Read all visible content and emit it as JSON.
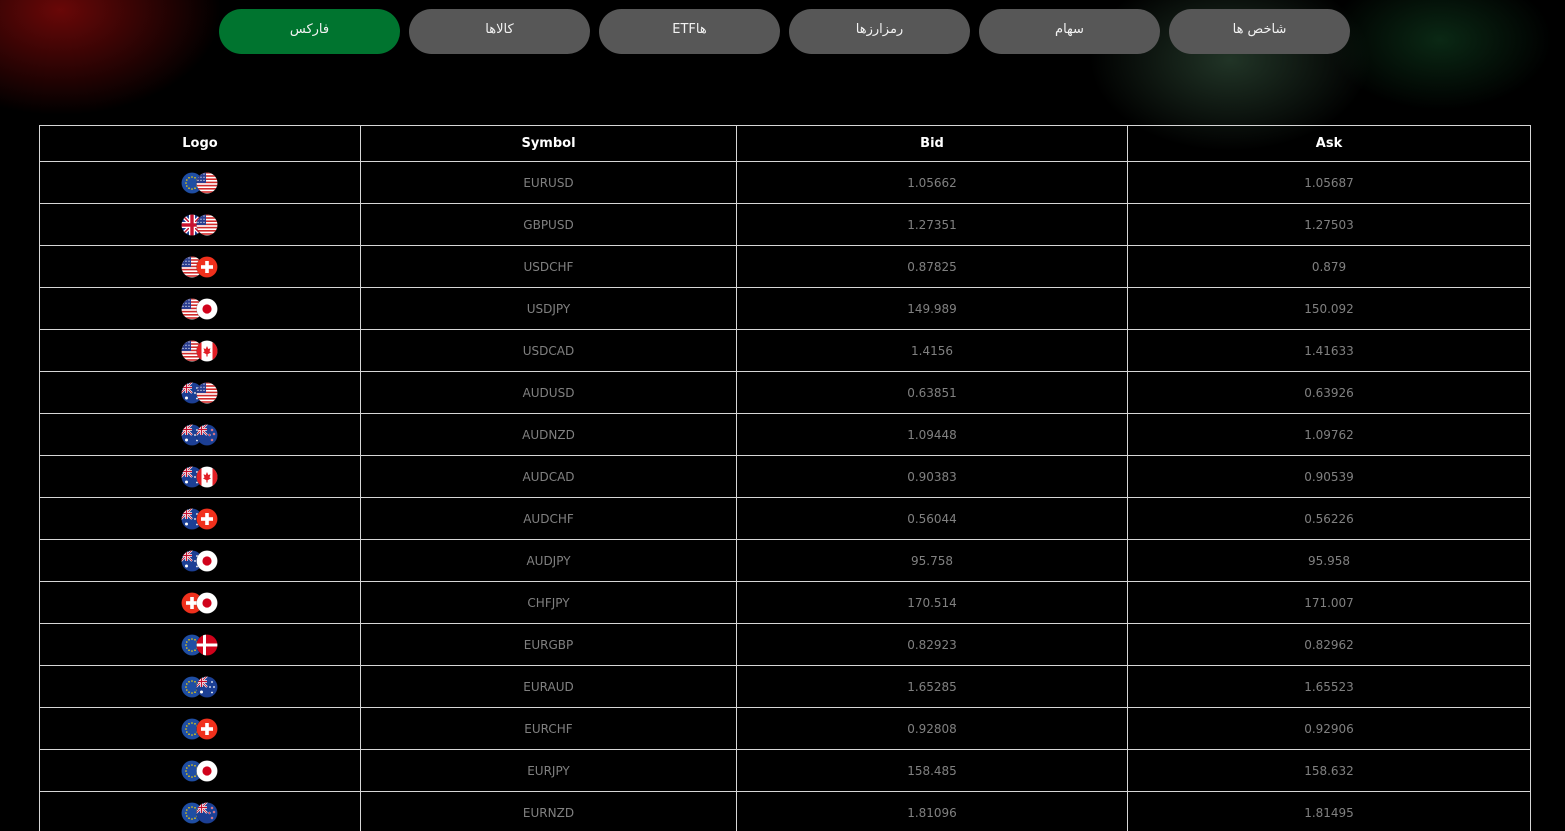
{
  "tabs": [
    {
      "label": "فارکس",
      "active": true
    },
    {
      "label": "کالاها",
      "active": false
    },
    {
      "label": "ETFها",
      "active": false
    },
    {
      "label": "رمزارزها",
      "active": false
    },
    {
      "label": "سهام",
      "active": false
    },
    {
      "label": "شاخص ها",
      "active": false
    }
  ],
  "table": {
    "headers": {
      "logo": "Logo",
      "symbol": "Symbol",
      "bid": "Bid",
      "ask": "Ask"
    },
    "rows": [
      {
        "symbol": "EURUSD",
        "bid": "1.05662",
        "ask": "1.05687",
        "flags": [
          "eu",
          "us"
        ]
      },
      {
        "symbol": "GBPUSD",
        "bid": "1.27351",
        "ask": "1.27503",
        "flags": [
          "gb",
          "us"
        ]
      },
      {
        "symbol": "USDCHF",
        "bid": "0.87825",
        "ask": "0.879",
        "flags": [
          "us",
          "ch"
        ]
      },
      {
        "symbol": "USDJPY",
        "bid": "149.989",
        "ask": "150.092",
        "flags": [
          "us",
          "jp"
        ]
      },
      {
        "symbol": "USDCAD",
        "bid": "1.4156",
        "ask": "1.41633",
        "flags": [
          "us",
          "ca"
        ]
      },
      {
        "symbol": "AUDUSD",
        "bid": "0.63851",
        "ask": "0.63926",
        "flags": [
          "au",
          "us"
        ]
      },
      {
        "symbol": "AUDNZD",
        "bid": "1.09448",
        "ask": "1.09762",
        "flags": [
          "au",
          "nz"
        ]
      },
      {
        "symbol": "AUDCAD",
        "bid": "0.90383",
        "ask": "0.90539",
        "flags": [
          "au",
          "ca"
        ]
      },
      {
        "symbol": "AUDCHF",
        "bid": "0.56044",
        "ask": "0.56226",
        "flags": [
          "au",
          "ch"
        ]
      },
      {
        "symbol": "AUDJPY",
        "bid": "95.758",
        "ask": "95.958",
        "flags": [
          "au",
          "jp"
        ]
      },
      {
        "symbol": "CHFJPY",
        "bid": "170.514",
        "ask": "171.007",
        "flags": [
          "ch",
          "jp"
        ]
      },
      {
        "symbol": "EURGBP",
        "bid": "0.82923",
        "ask": "0.82962",
        "flags": [
          "eu",
          "dk"
        ]
      },
      {
        "symbol": "EURAUD",
        "bid": "1.65285",
        "ask": "1.65523",
        "flags": [
          "eu",
          "au"
        ]
      },
      {
        "symbol": "EURCHF",
        "bid": "0.92808",
        "ask": "0.92906",
        "flags": [
          "eu",
          "ch"
        ]
      },
      {
        "symbol": "EURJPY",
        "bid": "158.485",
        "ask": "158.632",
        "flags": [
          "eu",
          "jp"
        ]
      },
      {
        "symbol": "EURNZD",
        "bid": "1.81096",
        "ask": "1.81495",
        "flags": [
          "eu",
          "nz"
        ]
      }
    ]
  },
  "colors": {
    "active_tab": "#00742f",
    "inactive_tab": "#575757",
    "table_border": "#d6d6d6",
    "cell_text": "#808080"
  }
}
